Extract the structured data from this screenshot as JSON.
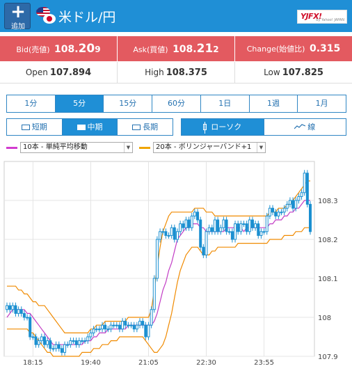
{
  "header": {
    "add_label": "追加",
    "pair_title": "米ドル/円",
    "logo_text": "YJFX!",
    "logo_sub": "by Yahoo! JAPAN"
  },
  "prices": {
    "bid": {
      "label": "Bid(売値)",
      "value_head": "108.",
      "value_big": "20",
      "value_tail": "9"
    },
    "ask": {
      "label": "Ask(買値)",
      "value_head": "108.",
      "value_big": "21",
      "value_tail": "2"
    },
    "change": {
      "label": "Change(始値比)",
      "value": "0.315"
    }
  },
  "ohl": {
    "open": {
      "label": "Open",
      "value": "107.894"
    },
    "high": {
      "label": "High",
      "value": "108.375"
    },
    "low": {
      "label": "Low",
      "value": "107.825"
    }
  },
  "timeframes": [
    "1分",
    "5分",
    "15分",
    "60分",
    "1日",
    "1週",
    "1月"
  ],
  "active_timeframe": "5分",
  "range_tabs": [
    "短期",
    "中期",
    "長期"
  ],
  "active_range": "中期",
  "chart_types": [
    "ローソク",
    "線"
  ],
  "active_chart_type": "ローソク",
  "indicators": [
    {
      "label": "10本 - 単純平均移動",
      "color": "#d23ccf"
    },
    {
      "label": "20本 - ボリンジャーバンド+1",
      "color": "#f0a500"
    }
  ],
  "colors": {
    "accent": "#1f8fd6",
    "price_bar": "#e35a60",
    "candle": "#1a8fd0",
    "sma": "#c23cc5",
    "bollinger": "#f08a00"
  },
  "chart_data": {
    "type": "candlestick",
    "x_ticks": [
      "18:15",
      "19:40",
      "21:05",
      "22:30",
      "23:55"
    ],
    "y_ticks": [
      "108.3",
      "108.2",
      "108.1",
      "108",
      "107.9"
    ],
    "ylim": [
      107.9,
      108.4
    ],
    "grid": true,
    "closes": [
      108.03,
      108.02,
      108.03,
      108.01,
      108.02,
      108.01,
      108.0,
      108.0,
      107.95,
      107.95,
      107.93,
      107.94,
      107.95,
      107.93,
      107.94,
      107.92,
      107.92,
      107.93,
      107.92,
      107.91,
      107.93,
      107.93,
      107.94,
      107.94,
      107.93,
      107.94,
      107.94,
      107.94,
      107.95,
      107.96,
      107.97,
      107.97,
      107.97,
      107.98,
      107.97,
      107.97,
      107.98,
      107.98,
      107.98,
      107.97,
      107.99,
      107.98,
      107.98,
      107.98,
      107.97,
      107.98,
      107.99,
      107.98,
      107.95,
      107.98,
      108.02,
      108.1,
      108.2,
      108.22,
      108.22,
      108.21,
      108.21,
      108.23,
      108.2,
      108.22,
      108.24,
      108.23,
      108.25,
      108.23,
      108.26,
      108.27,
      108.25,
      108.18,
      108.16,
      108.22,
      108.23,
      108.22,
      108.25,
      108.22,
      108.23,
      108.25,
      108.22,
      108.22,
      108.2,
      108.24,
      108.22,
      108.24,
      108.24,
      108.22,
      108.25,
      108.23,
      108.24,
      108.21,
      108.22,
      108.22,
      108.26,
      108.28,
      108.27,
      108.26,
      108.27,
      108.27,
      108.28,
      108.29,
      108.3,
      108.28,
      108.3,
      108.31,
      108.32,
      108.37,
      108.29,
      108.22
    ],
    "sma10": [
      108.0,
      108.01,
      108.02,
      108.02,
      108.02,
      108.02,
      108.02,
      108.01,
      108.01,
      108.0,
      107.99,
      107.98,
      107.97,
      107.96,
      107.95,
      107.94,
      107.93,
      107.93,
      107.93,
      107.93,
      107.93,
      107.93,
      107.93,
      107.93,
      107.93,
      107.93,
      107.93,
      107.94,
      107.94,
      107.94,
      107.95,
      107.95,
      107.96,
      107.96,
      107.96,
      107.97,
      107.97,
      107.97,
      107.97,
      107.97,
      107.97,
      107.97,
      107.98,
      107.98,
      107.98,
      107.98,
      107.98,
      107.98,
      107.98,
      107.98,
      107.98,
      107.99,
      108.01,
      108.04,
      108.07,
      108.09,
      108.12,
      108.14,
      108.17,
      108.2,
      108.21,
      108.22,
      108.23,
      108.23,
      108.24,
      108.24,
      108.24,
      108.23,
      108.23,
      108.22,
      108.22,
      108.22,
      108.22,
      108.22,
      108.22,
      108.22,
      108.23,
      108.23,
      108.23,
      108.23,
      108.23,
      108.23,
      108.22,
      108.23,
      108.23,
      108.23,
      108.23,
      108.23,
      108.23,
      108.23,
      108.23,
      108.24,
      108.24,
      108.25,
      108.25,
      108.25,
      108.26,
      108.26,
      108.27,
      108.27,
      108.28,
      108.28,
      108.29,
      108.3,
      108.3,
      108.3
    ],
    "bb_upper": [
      108.08,
      108.08,
      108.08,
      108.08,
      108.07,
      108.07,
      108.06,
      108.06,
      108.05,
      108.04,
      108.04,
      108.03,
      108.03,
      108.03,
      108.02,
      108.01,
      108.0,
      107.99,
      107.98,
      107.97,
      107.96,
      107.96,
      107.96,
      107.96,
      107.96,
      107.96,
      107.96,
      107.96,
      107.96,
      107.97,
      107.97,
      107.98,
      107.98,
      107.98,
      107.99,
      107.99,
      107.99,
      107.99,
      107.99,
      107.99,
      107.99,
      107.99,
      108.0,
      108.0,
      108.0,
      108.0,
      108.0,
      108.0,
      108.0,
      108.0,
      108.02,
      108.07,
      108.13,
      108.18,
      108.22,
      108.24,
      108.26,
      108.27,
      108.27,
      108.27,
      108.27,
      108.27,
      108.27,
      108.27,
      108.27,
      108.28,
      108.28,
      108.28,
      108.28,
      108.27,
      108.27,
      108.27,
      108.26,
      108.26,
      108.26,
      108.26,
      108.26,
      108.26,
      108.26,
      108.26,
      108.26,
      108.26,
      108.26,
      108.26,
      108.26,
      108.26,
      108.26,
      108.26,
      108.26,
      108.26,
      108.26,
      108.27,
      108.27,
      108.27,
      108.28,
      108.28,
      108.28,
      108.29,
      108.29,
      108.3,
      108.31,
      108.32,
      108.33,
      108.34,
      108.35,
      108.35
    ],
    "bb_lower": [
      107.97,
      107.97,
      107.97,
      107.97,
      107.97,
      107.97,
      107.97,
      107.97,
      107.96,
      107.96,
      107.95,
      107.94,
      107.93,
      107.92,
      107.91,
      107.91,
      107.9,
      107.9,
      107.9,
      107.9,
      107.9,
      107.9,
      107.9,
      107.9,
      107.9,
      107.9,
      107.91,
      107.91,
      107.91,
      107.91,
      107.92,
      107.92,
      107.92,
      107.93,
      107.93,
      107.93,
      107.94,
      107.94,
      107.94,
      107.95,
      107.95,
      107.95,
      107.95,
      107.95,
      107.95,
      107.95,
      107.95,
      107.95,
      107.94,
      107.93,
      107.92,
      107.91,
      107.91,
      107.92,
      107.93,
      107.95,
      107.98,
      108.01,
      108.05,
      108.09,
      108.12,
      108.14,
      108.16,
      108.17,
      108.18,
      108.18,
      108.18,
      108.17,
      108.16,
      108.16,
      108.16,
      108.17,
      108.17,
      108.18,
      108.18,
      108.18,
      108.18,
      108.18,
      108.18,
      108.18,
      108.19,
      108.19,
      108.19,
      108.19,
      108.19,
      108.19,
      108.19,
      108.19,
      108.19,
      108.19,
      108.19,
      108.2,
      108.2,
      108.2,
      108.2,
      108.2,
      108.21,
      108.21,
      108.21,
      108.21,
      108.22,
      108.22,
      108.22,
      108.23,
      108.23,
      108.23
    ]
  }
}
